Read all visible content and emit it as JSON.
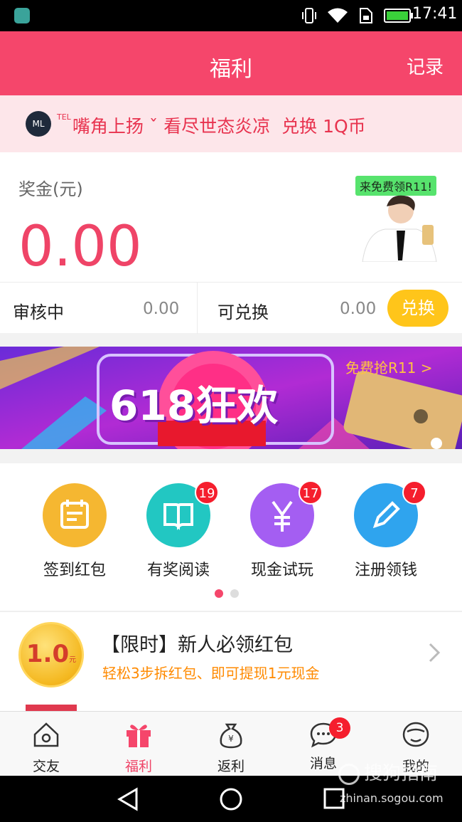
{
  "status_bar": {
    "time": "17:41"
  },
  "header": {
    "title": "福利",
    "record_label": "记录"
  },
  "notice": {
    "sender": "嘴角上扬",
    "sender_suffix": "ˇ",
    "message": "看尽世态炎凉",
    "reward": "兑换 1Q币",
    "avatar_text": "ML",
    "sender_sup": "TEL"
  },
  "bonus": {
    "label": "奖金(元)",
    "amount": "0.00",
    "promo_badge": "来免费领R11!"
  },
  "balances": {
    "pending_label": "审核中",
    "pending_value": "0.00",
    "redeemable_label": "可兑换",
    "redeemable_value": "0.00",
    "exchange_label": "兑换"
  },
  "banner": {
    "title": "618狂欢",
    "link_text": "免费抢R11 >"
  },
  "grid": [
    {
      "label": "签到红包",
      "icon": "calendar-icon",
      "color": "#f5b731",
      "badge": ""
    },
    {
      "label": "有奖阅读",
      "icon": "book-icon",
      "color": "#22c7c2",
      "badge": "19"
    },
    {
      "label": "现金试玩",
      "icon": "yen-icon",
      "color": "#a45ef2",
      "badge": "17"
    },
    {
      "label": "注册领钱",
      "icon": "pencil-icon",
      "color": "#2fa4ee",
      "badge": "7"
    }
  ],
  "promo": {
    "coin_text": "1.0",
    "coin_unit": "元",
    "title": "【限时】新人必领红包",
    "subtitle": "轻松3步拆红包、即可提现1元现金"
  },
  "tabs": [
    {
      "label": "交友",
      "icon": "home-icon"
    },
    {
      "label": "福利",
      "icon": "gift-icon",
      "active": true
    },
    {
      "label": "返利",
      "icon": "money-bag-icon"
    },
    {
      "label": "消息",
      "icon": "chat-icon",
      "badge": "3"
    },
    {
      "label": "我的",
      "icon": "face-icon"
    }
  ],
  "watermark": {
    "brand": "搜狗指南",
    "url": "zhinan.sogou.com"
  },
  "colors": {
    "primary": "#f5466b",
    "accent": "#ffc51a",
    "highlight": "#ef4467"
  }
}
